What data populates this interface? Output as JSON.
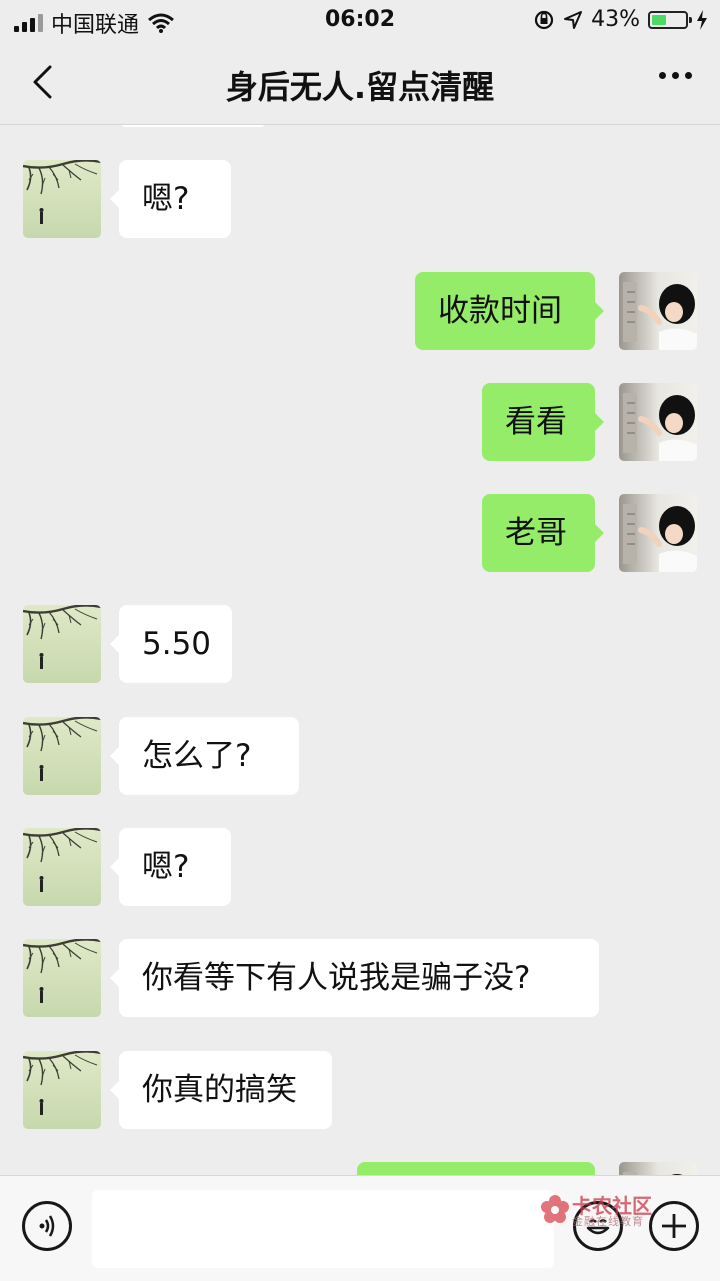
{
  "status_bar": {
    "carrier": "中国联通",
    "time": "06:02",
    "battery_percent": "43%",
    "battery_level": 0.43,
    "icons": [
      "signal-icon",
      "wifi-icon",
      "orientation-lock-icon",
      "location-icon",
      "battery-icon",
      "charging-icon"
    ]
  },
  "header": {
    "title": "身后无人.留点清醒",
    "back_icon": "chevron-left-icon",
    "more_icon": "more-dots-icon"
  },
  "messages": [
    {
      "side": "left",
      "text": "嗯?"
    },
    {
      "side": "right",
      "text": "收款时间"
    },
    {
      "side": "right",
      "text": "看看"
    },
    {
      "side": "right",
      "text": "老哥"
    },
    {
      "side": "left",
      "text": "5.50"
    },
    {
      "side": "left",
      "text": "怎么了?"
    },
    {
      "side": "left",
      "text": "嗯?"
    },
    {
      "side": "left",
      "text": "你看等下有人说我是骗子没?"
    },
    {
      "side": "left",
      "text": "你真的搞笑"
    },
    {
      "side": "right",
      "text": ""
    }
  ],
  "input_bar": {
    "voice_icon": "voice-icon",
    "emoji_icon": "emoji-icon",
    "plus_icon": "plus-icon",
    "input_value": ""
  },
  "watermark": {
    "text": "卡农社区",
    "subtext": "金融在线教育"
  },
  "colors": {
    "background": "#ededed",
    "sent_bubble": "#95ec69",
    "received_bubble": "#ffffff"
  }
}
